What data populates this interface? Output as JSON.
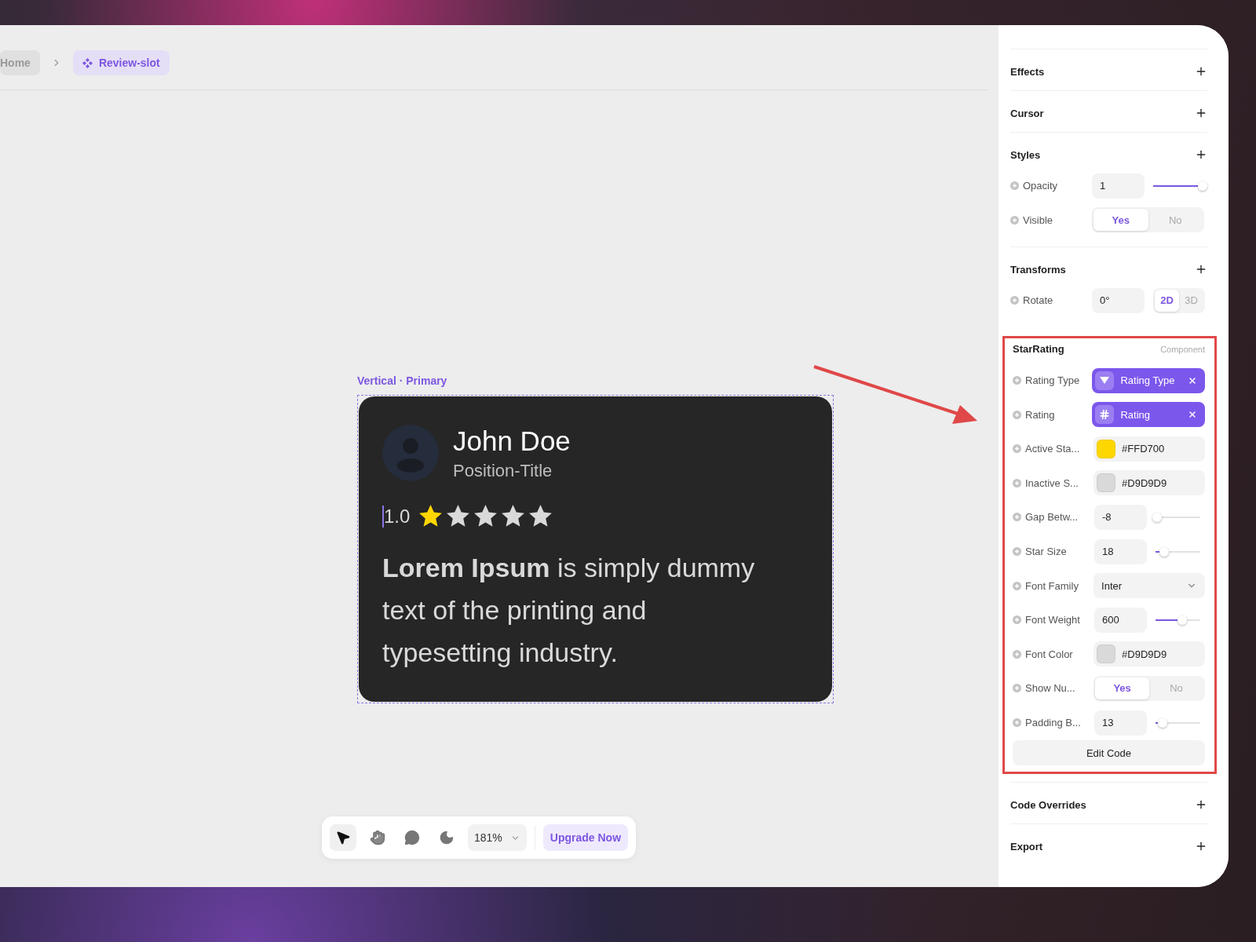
{
  "breadcrumb": [
    {
      "label": "Home",
      "kind": "page",
      "selected": false
    },
    {
      "label": "Review-slot",
      "kind": "component",
      "selected": true
    }
  ],
  "canvas": {
    "frame_label": "Vertical · Primary",
    "card": {
      "name": "John Doe",
      "title": "Position-Title",
      "rating": "1.0",
      "stars": 1,
      "body": "**Lorem Ipsum** is simply dummy text of the printing and typesetting industry."
    }
  },
  "toolbar": {
    "tools": [
      {
        "kind": "pointer",
        "selected": true
      },
      {
        "kind": "hand",
        "selected": false
      },
      {
        "kind": "comment",
        "selected": false
      },
      {
        "kind": "theme",
        "selected": false
      }
    ],
    "zoom": "181%",
    "upgrade": "Upgrade Now"
  },
  "panel": {
    "sections": [
      {
        "title": "Effects",
        "highlighted": false
      },
      {
        "title": "Cursor",
        "highlighted": false
      },
      {
        "title": "Styles",
        "highlighted": false,
        "props": [
          {
            "label": "Opacity",
            "kind": "slider",
            "value": "1",
            "level": 1
          },
          {
            "label": "Visible",
            "kind": "toggle",
            "options": [
              {
                "label": "Yes",
                "selected": true
              },
              {
                "label": "No",
                "selected": false
              }
            ]
          }
        ]
      },
      {
        "title": "Transforms",
        "highlighted": false,
        "props": [
          {
            "label": "Rotate",
            "kind": "segmented",
            "value": "0°",
            "options": [
              {
                "label": "2D",
                "selected": true
              },
              {
                "label": "3D",
                "selected": false
              }
            ]
          }
        ]
      },
      {
        "title": "StarRating",
        "badge": "Component",
        "highlighted": true,
        "button": "Edit Code",
        "props": [
          {
            "label": "Rating Type",
            "kind": "variable_enum",
            "value": "Rating Type"
          },
          {
            "label": "Rating",
            "kind": "variable_number",
            "value": "Rating"
          },
          {
            "label": "Active Sta...",
            "kind": "color",
            "value": "#FFD700",
            "color": "#ffd700"
          },
          {
            "label": "Inactive S...",
            "kind": "color",
            "value": "#D9D9D9",
            "color": "#d9d9d9"
          },
          {
            "label": "Gap Betw...",
            "kind": "slider",
            "value": "-8",
            "level": 0.04
          },
          {
            "label": "Star Size",
            "kind": "slider",
            "value": "18",
            "level": 0.2
          },
          {
            "label": "Font Family",
            "kind": "select",
            "value": "Inter"
          },
          {
            "label": "Font Weight",
            "kind": "slider",
            "value": "600",
            "level": 0.6
          },
          {
            "label": "Font Color",
            "kind": "color",
            "value": "#D9D9D9",
            "color": "#d9d9d9"
          },
          {
            "label": "Show Nu...",
            "kind": "toggle",
            "options": [
              {
                "label": "Yes",
                "selected": true
              },
              {
                "label": "No",
                "selected": false
              }
            ]
          },
          {
            "label": "Padding B...",
            "kind": "slider",
            "value": "13",
            "level": 0.16
          }
        ]
      },
      {
        "title": "Code Overrides",
        "highlighted": false
      },
      {
        "title": "Export",
        "highlighted": false
      }
    ]
  }
}
